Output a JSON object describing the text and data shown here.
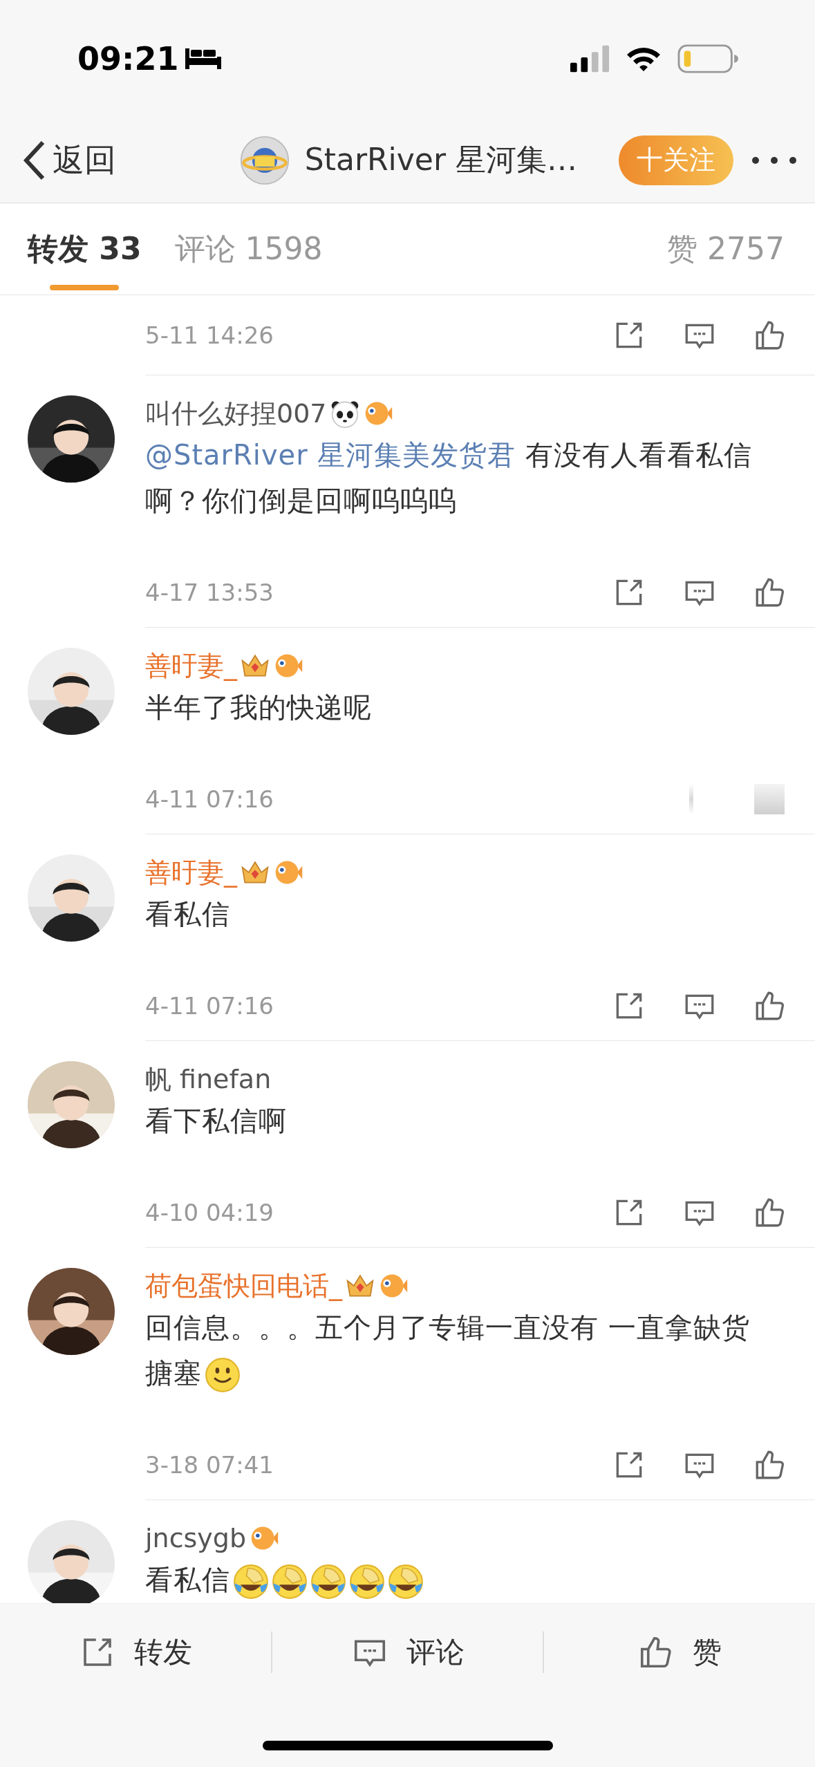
{
  "status_bar": {
    "time": "09:21"
  },
  "nav": {
    "back": "返回",
    "title": "StarRiver 星河集…",
    "follow": "十关注"
  },
  "tabs": [
    {
      "label": "转发",
      "count": "33",
      "selected": true
    },
    {
      "label": "评论",
      "count": "1598",
      "selected": false
    },
    {
      "label": "赞",
      "count": "2757",
      "selected": false
    }
  ],
  "top_item": {
    "time": "5-11 14:26",
    "actions_faded": false
  },
  "comments": [
    {
      "name": "叫什么好捏007",
      "vip": false,
      "badges": [
        {
          "kind": "panda"
        },
        {
          "kind": "fish"
        }
      ],
      "body": [
        {
          "kind": "mention",
          "text": "@StarRiver 星河集美发货君"
        },
        {
          "kind": "text",
          "text": " 有没有人看看私信啊？你们倒是回啊呜呜呜"
        }
      ],
      "time": "4-17 13:53",
      "actions_faded": false
    },
    {
      "name": "善旴妻_",
      "vip": true,
      "badges": [
        {
          "kind": "crown"
        },
        {
          "kind": "fish"
        }
      ],
      "body": [
        {
          "kind": "text",
          "text": "半年了我的快递呢"
        }
      ],
      "time": "4-11 07:16",
      "actions_faded": true
    },
    {
      "name": "善旴妻_",
      "vip": true,
      "badges": [
        {
          "kind": "crown"
        },
        {
          "kind": "fish"
        }
      ],
      "body": [
        {
          "kind": "text",
          "text": "看私信"
        }
      ],
      "time": "4-11 07:16",
      "actions_faded": false
    },
    {
      "name": "帆 finefan",
      "vip": false,
      "body": [
        {
          "kind": "text",
          "text": "看下私信啊"
        }
      ],
      "time": "4-10 04:19",
      "actions_faded": false
    },
    {
      "name": "荷包蛋快回电话_",
      "vip": true,
      "badges": [
        {
          "kind": "crown"
        },
        {
          "kind": "fish"
        }
      ],
      "body": [
        {
          "kind": "text",
          "text": "回信息。。。五个月了专辑一直没有 一直拿缺货搪塞"
        },
        {
          "kind": "smile-emoji"
        }
      ],
      "time": "3-18 07:41",
      "actions_faded": false
    },
    {
      "name": "jncsygb",
      "vip": false,
      "badges": [
        {
          "kind": "fish"
        }
      ],
      "body": [
        {
          "kind": "text",
          "text": "看私信"
        },
        {
          "kind": "laugh-emoji"
        },
        {
          "kind": "laugh-emoji"
        },
        {
          "kind": "laugh-emoji"
        },
        {
          "kind": "laugh-emoji"
        },
        {
          "kind": "laugh-emoji"
        }
      ]
    }
  ],
  "bottom_bar": [
    {
      "kind": "share",
      "label": "转发"
    },
    {
      "kind": "comment",
      "label": "评论"
    },
    {
      "kind": "like",
      "label": "赞"
    }
  ]
}
